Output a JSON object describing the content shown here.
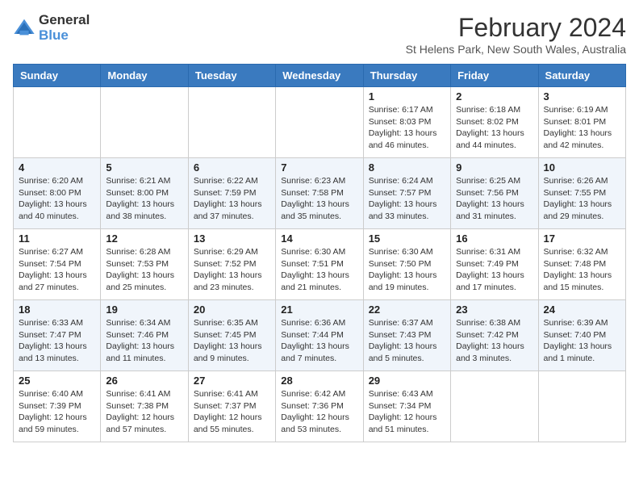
{
  "logo": {
    "general": "General",
    "blue": "Blue"
  },
  "title": "February 2024",
  "subtitle": "St Helens Park, New South Wales, Australia",
  "days_of_week": [
    "Sunday",
    "Monday",
    "Tuesday",
    "Wednesday",
    "Thursday",
    "Friday",
    "Saturday"
  ],
  "weeks": [
    [
      {
        "day": "",
        "info": ""
      },
      {
        "day": "",
        "info": ""
      },
      {
        "day": "",
        "info": ""
      },
      {
        "day": "",
        "info": ""
      },
      {
        "day": "1",
        "info": "Sunrise: 6:17 AM\nSunset: 8:03 PM\nDaylight: 13 hours and 46 minutes."
      },
      {
        "day": "2",
        "info": "Sunrise: 6:18 AM\nSunset: 8:02 PM\nDaylight: 13 hours and 44 minutes."
      },
      {
        "day": "3",
        "info": "Sunrise: 6:19 AM\nSunset: 8:01 PM\nDaylight: 13 hours and 42 minutes."
      }
    ],
    [
      {
        "day": "4",
        "info": "Sunrise: 6:20 AM\nSunset: 8:00 PM\nDaylight: 13 hours and 40 minutes."
      },
      {
        "day": "5",
        "info": "Sunrise: 6:21 AM\nSunset: 8:00 PM\nDaylight: 13 hours and 38 minutes."
      },
      {
        "day": "6",
        "info": "Sunrise: 6:22 AM\nSunset: 7:59 PM\nDaylight: 13 hours and 37 minutes."
      },
      {
        "day": "7",
        "info": "Sunrise: 6:23 AM\nSunset: 7:58 PM\nDaylight: 13 hours and 35 minutes."
      },
      {
        "day": "8",
        "info": "Sunrise: 6:24 AM\nSunset: 7:57 PM\nDaylight: 13 hours and 33 minutes."
      },
      {
        "day": "9",
        "info": "Sunrise: 6:25 AM\nSunset: 7:56 PM\nDaylight: 13 hours and 31 minutes."
      },
      {
        "day": "10",
        "info": "Sunrise: 6:26 AM\nSunset: 7:55 PM\nDaylight: 13 hours and 29 minutes."
      }
    ],
    [
      {
        "day": "11",
        "info": "Sunrise: 6:27 AM\nSunset: 7:54 PM\nDaylight: 13 hours and 27 minutes."
      },
      {
        "day": "12",
        "info": "Sunrise: 6:28 AM\nSunset: 7:53 PM\nDaylight: 13 hours and 25 minutes."
      },
      {
        "day": "13",
        "info": "Sunrise: 6:29 AM\nSunset: 7:52 PM\nDaylight: 13 hours and 23 minutes."
      },
      {
        "day": "14",
        "info": "Sunrise: 6:30 AM\nSunset: 7:51 PM\nDaylight: 13 hours and 21 minutes."
      },
      {
        "day": "15",
        "info": "Sunrise: 6:30 AM\nSunset: 7:50 PM\nDaylight: 13 hours and 19 minutes."
      },
      {
        "day": "16",
        "info": "Sunrise: 6:31 AM\nSunset: 7:49 PM\nDaylight: 13 hours and 17 minutes."
      },
      {
        "day": "17",
        "info": "Sunrise: 6:32 AM\nSunset: 7:48 PM\nDaylight: 13 hours and 15 minutes."
      }
    ],
    [
      {
        "day": "18",
        "info": "Sunrise: 6:33 AM\nSunset: 7:47 PM\nDaylight: 13 hours and 13 minutes."
      },
      {
        "day": "19",
        "info": "Sunrise: 6:34 AM\nSunset: 7:46 PM\nDaylight: 13 hours and 11 minutes."
      },
      {
        "day": "20",
        "info": "Sunrise: 6:35 AM\nSunset: 7:45 PM\nDaylight: 13 hours and 9 minutes."
      },
      {
        "day": "21",
        "info": "Sunrise: 6:36 AM\nSunset: 7:44 PM\nDaylight: 13 hours and 7 minutes."
      },
      {
        "day": "22",
        "info": "Sunrise: 6:37 AM\nSunset: 7:43 PM\nDaylight: 13 hours and 5 minutes."
      },
      {
        "day": "23",
        "info": "Sunrise: 6:38 AM\nSunset: 7:42 PM\nDaylight: 13 hours and 3 minutes."
      },
      {
        "day": "24",
        "info": "Sunrise: 6:39 AM\nSunset: 7:40 PM\nDaylight: 13 hours and 1 minute."
      }
    ],
    [
      {
        "day": "25",
        "info": "Sunrise: 6:40 AM\nSunset: 7:39 PM\nDaylight: 12 hours and 59 minutes."
      },
      {
        "day": "26",
        "info": "Sunrise: 6:41 AM\nSunset: 7:38 PM\nDaylight: 12 hours and 57 minutes."
      },
      {
        "day": "27",
        "info": "Sunrise: 6:41 AM\nSunset: 7:37 PM\nDaylight: 12 hours and 55 minutes."
      },
      {
        "day": "28",
        "info": "Sunrise: 6:42 AM\nSunset: 7:36 PM\nDaylight: 12 hours and 53 minutes."
      },
      {
        "day": "29",
        "info": "Sunrise: 6:43 AM\nSunset: 7:34 PM\nDaylight: 12 hours and 51 minutes."
      },
      {
        "day": "",
        "info": ""
      },
      {
        "day": "",
        "info": ""
      }
    ]
  ]
}
